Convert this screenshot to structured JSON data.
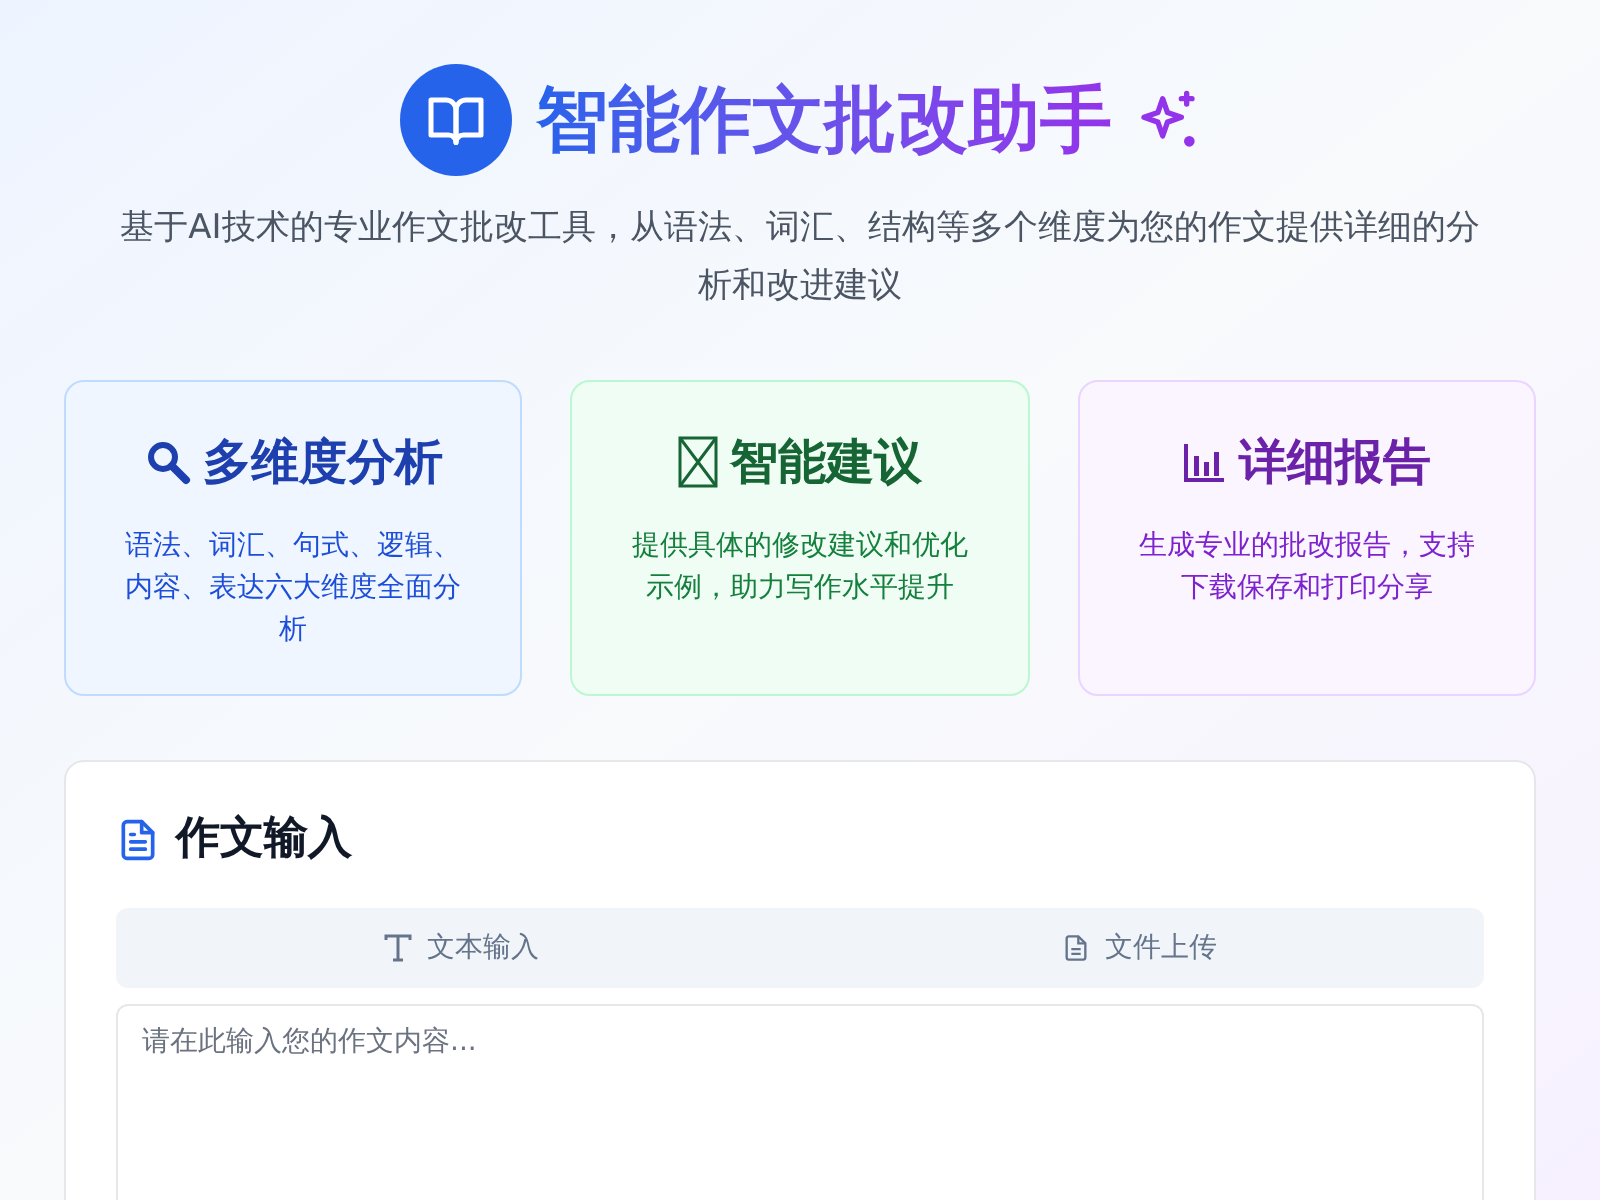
{
  "header": {
    "title": "智能作文批改助手",
    "subtitle": "基于AI技术的专业作文批改工具，从语法、词汇、结构等多个维度为您的作文提供详细的分析和改进建议"
  },
  "features": [
    {
      "kind": "analysis",
      "title": "多维度分析",
      "description": "语法、词汇、句式、逻辑、内容、表达六大维度全面分析"
    },
    {
      "kind": "suggestion",
      "title": "智能建议",
      "description": "提供具体的修改建议和优化示例，助力写作水平提升"
    },
    {
      "kind": "report",
      "title": "详细报告",
      "description": "生成专业的批改报告，支持下载保存和打印分享"
    }
  ],
  "input_panel": {
    "title": "作文输入",
    "tabs": [
      {
        "kind": "text",
        "label": "文本输入",
        "selected": false
      },
      {
        "kind": "file",
        "label": "文件上传",
        "selected": false
      }
    ],
    "placeholder": "请在此输入您的作文内容..."
  }
}
